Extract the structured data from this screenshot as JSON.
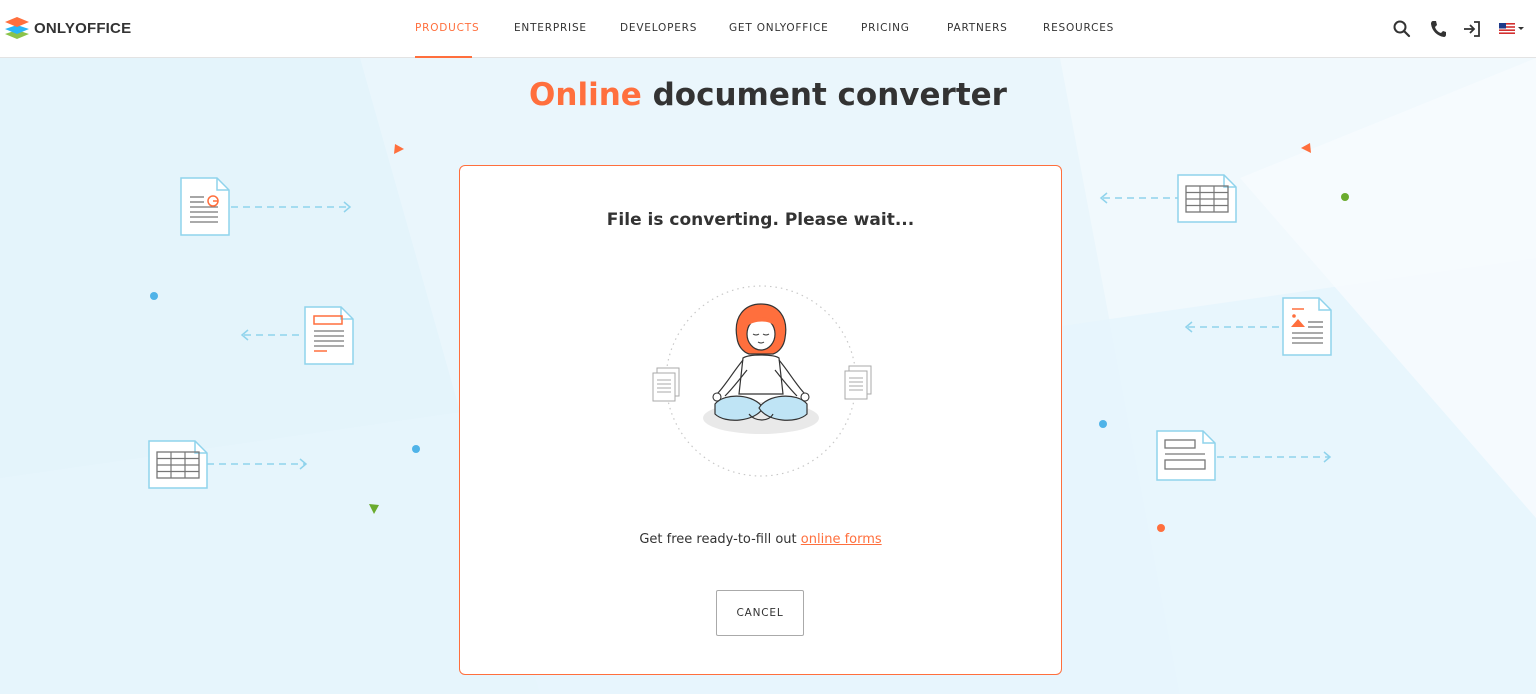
{
  "header": {
    "logo_text": "ONLYOFFICE",
    "nav": [
      {
        "label": "PRODUCTS",
        "active": true
      },
      {
        "label": "ENTERPRISE",
        "active": false
      },
      {
        "label": "DEVELOPERS",
        "active": false
      },
      {
        "label": "GET ONLYOFFICE",
        "active": false
      },
      {
        "label": "PRICING",
        "active": false
      },
      {
        "label": "PARTNERS",
        "active": false
      },
      {
        "label": "RESOURCES",
        "active": false
      }
    ],
    "icons": [
      "search-icon",
      "phone-icon",
      "sign-in-icon",
      "us-flag-icon"
    ]
  },
  "page": {
    "title_accent": "Online",
    "title_rest": "document converter"
  },
  "dialog": {
    "status": "File is converting. Please wait...",
    "promo_text": "Get free ready-to-fill out",
    "promo_link": "online forms",
    "cancel_label": "CANCEL"
  },
  "colors": {
    "accent": "#ff6f3d",
    "background": "#eaf6fc",
    "doc_border": "#8fd3ec",
    "arrow": "#8fd3ec"
  }
}
